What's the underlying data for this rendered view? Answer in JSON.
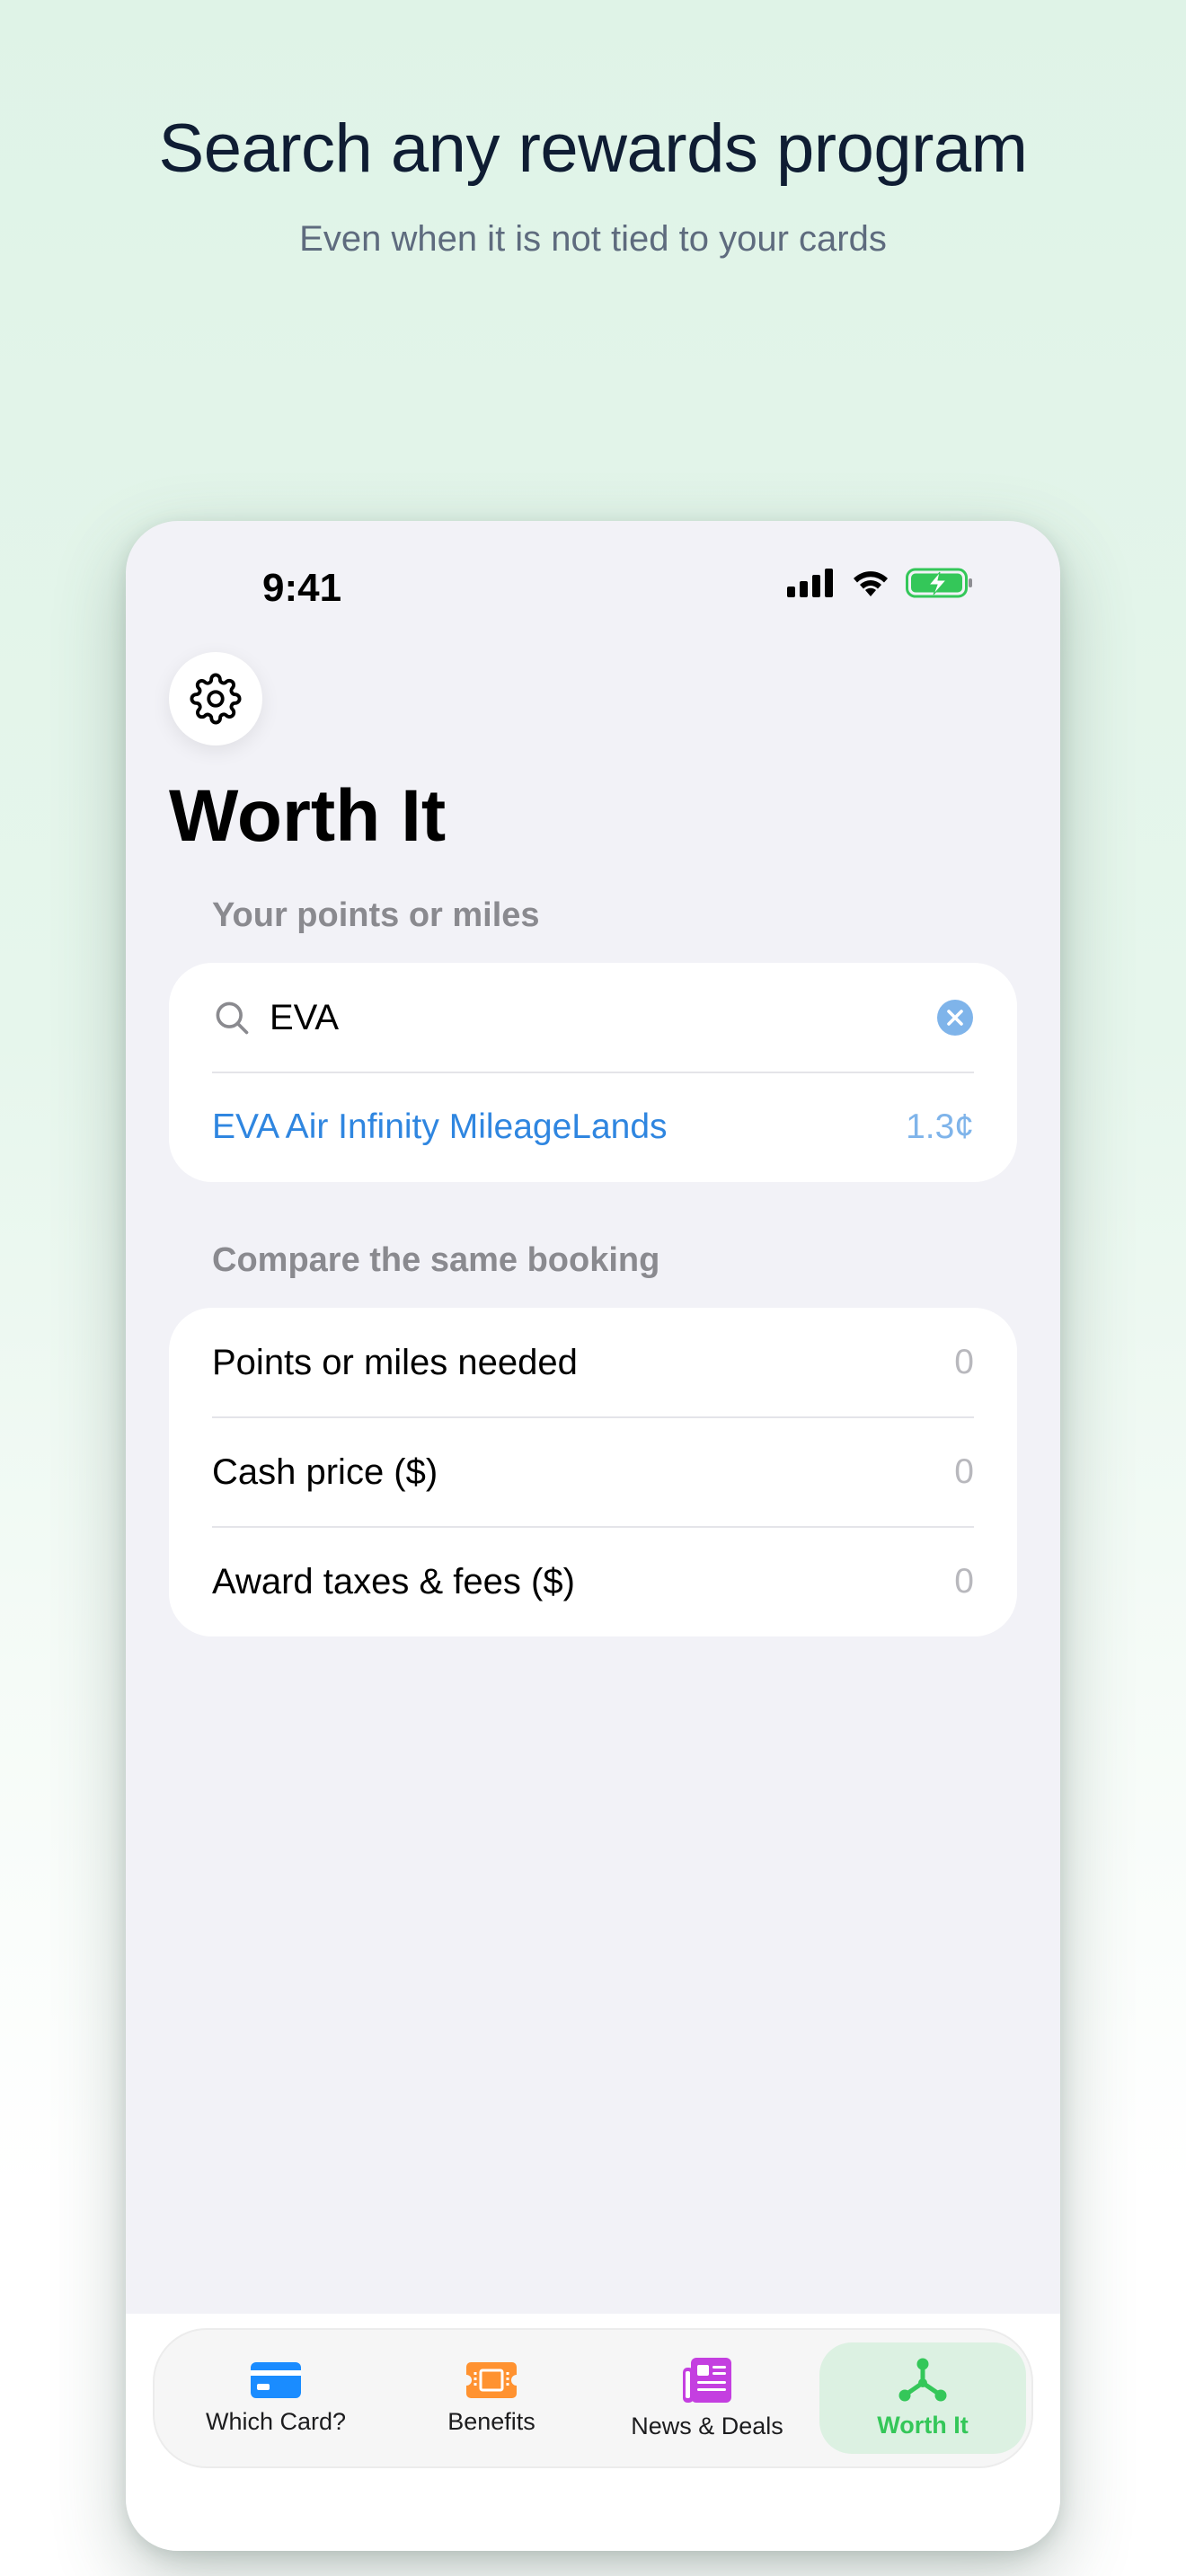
{
  "hero": {
    "title": "Search any rewards program",
    "subtitle": "Even when it is not tied to your cards"
  },
  "status_bar": {
    "time": "9:41"
  },
  "icons": {
    "settings": "gear-icon",
    "search": "search-icon",
    "clear": "clear-icon"
  },
  "page": {
    "title": "Worth It"
  },
  "points_section": {
    "label": "Your points or miles",
    "search_value": "EVA",
    "result": {
      "name": "EVA Air Infinity MileageLands",
      "value": "1.3¢"
    }
  },
  "compare_section": {
    "label": "Compare the same booking",
    "rows": [
      {
        "label": "Points or miles needed",
        "value": "0"
      },
      {
        "label": "Cash price ($)",
        "value": "0"
      },
      {
        "label": "Award taxes & fees ($)",
        "value": "0"
      }
    ]
  },
  "tabs": [
    {
      "label": "Which Card?",
      "icon": "credit-card-icon",
      "color": "#1a8cff",
      "active": false
    },
    {
      "label": "Benefits",
      "icon": "ticket-icon",
      "color": "#ff9230",
      "active": false
    },
    {
      "label": "News & Deals",
      "icon": "newspaper-icon",
      "color": "#c43fe0",
      "active": false
    },
    {
      "label": "Worth It",
      "icon": "network-icon",
      "color": "#34c759",
      "active": true
    }
  ],
  "colors": {
    "accent_blue": "#2f86e0",
    "active_tab_green": "#34c759",
    "battery_green": "#34c759"
  }
}
